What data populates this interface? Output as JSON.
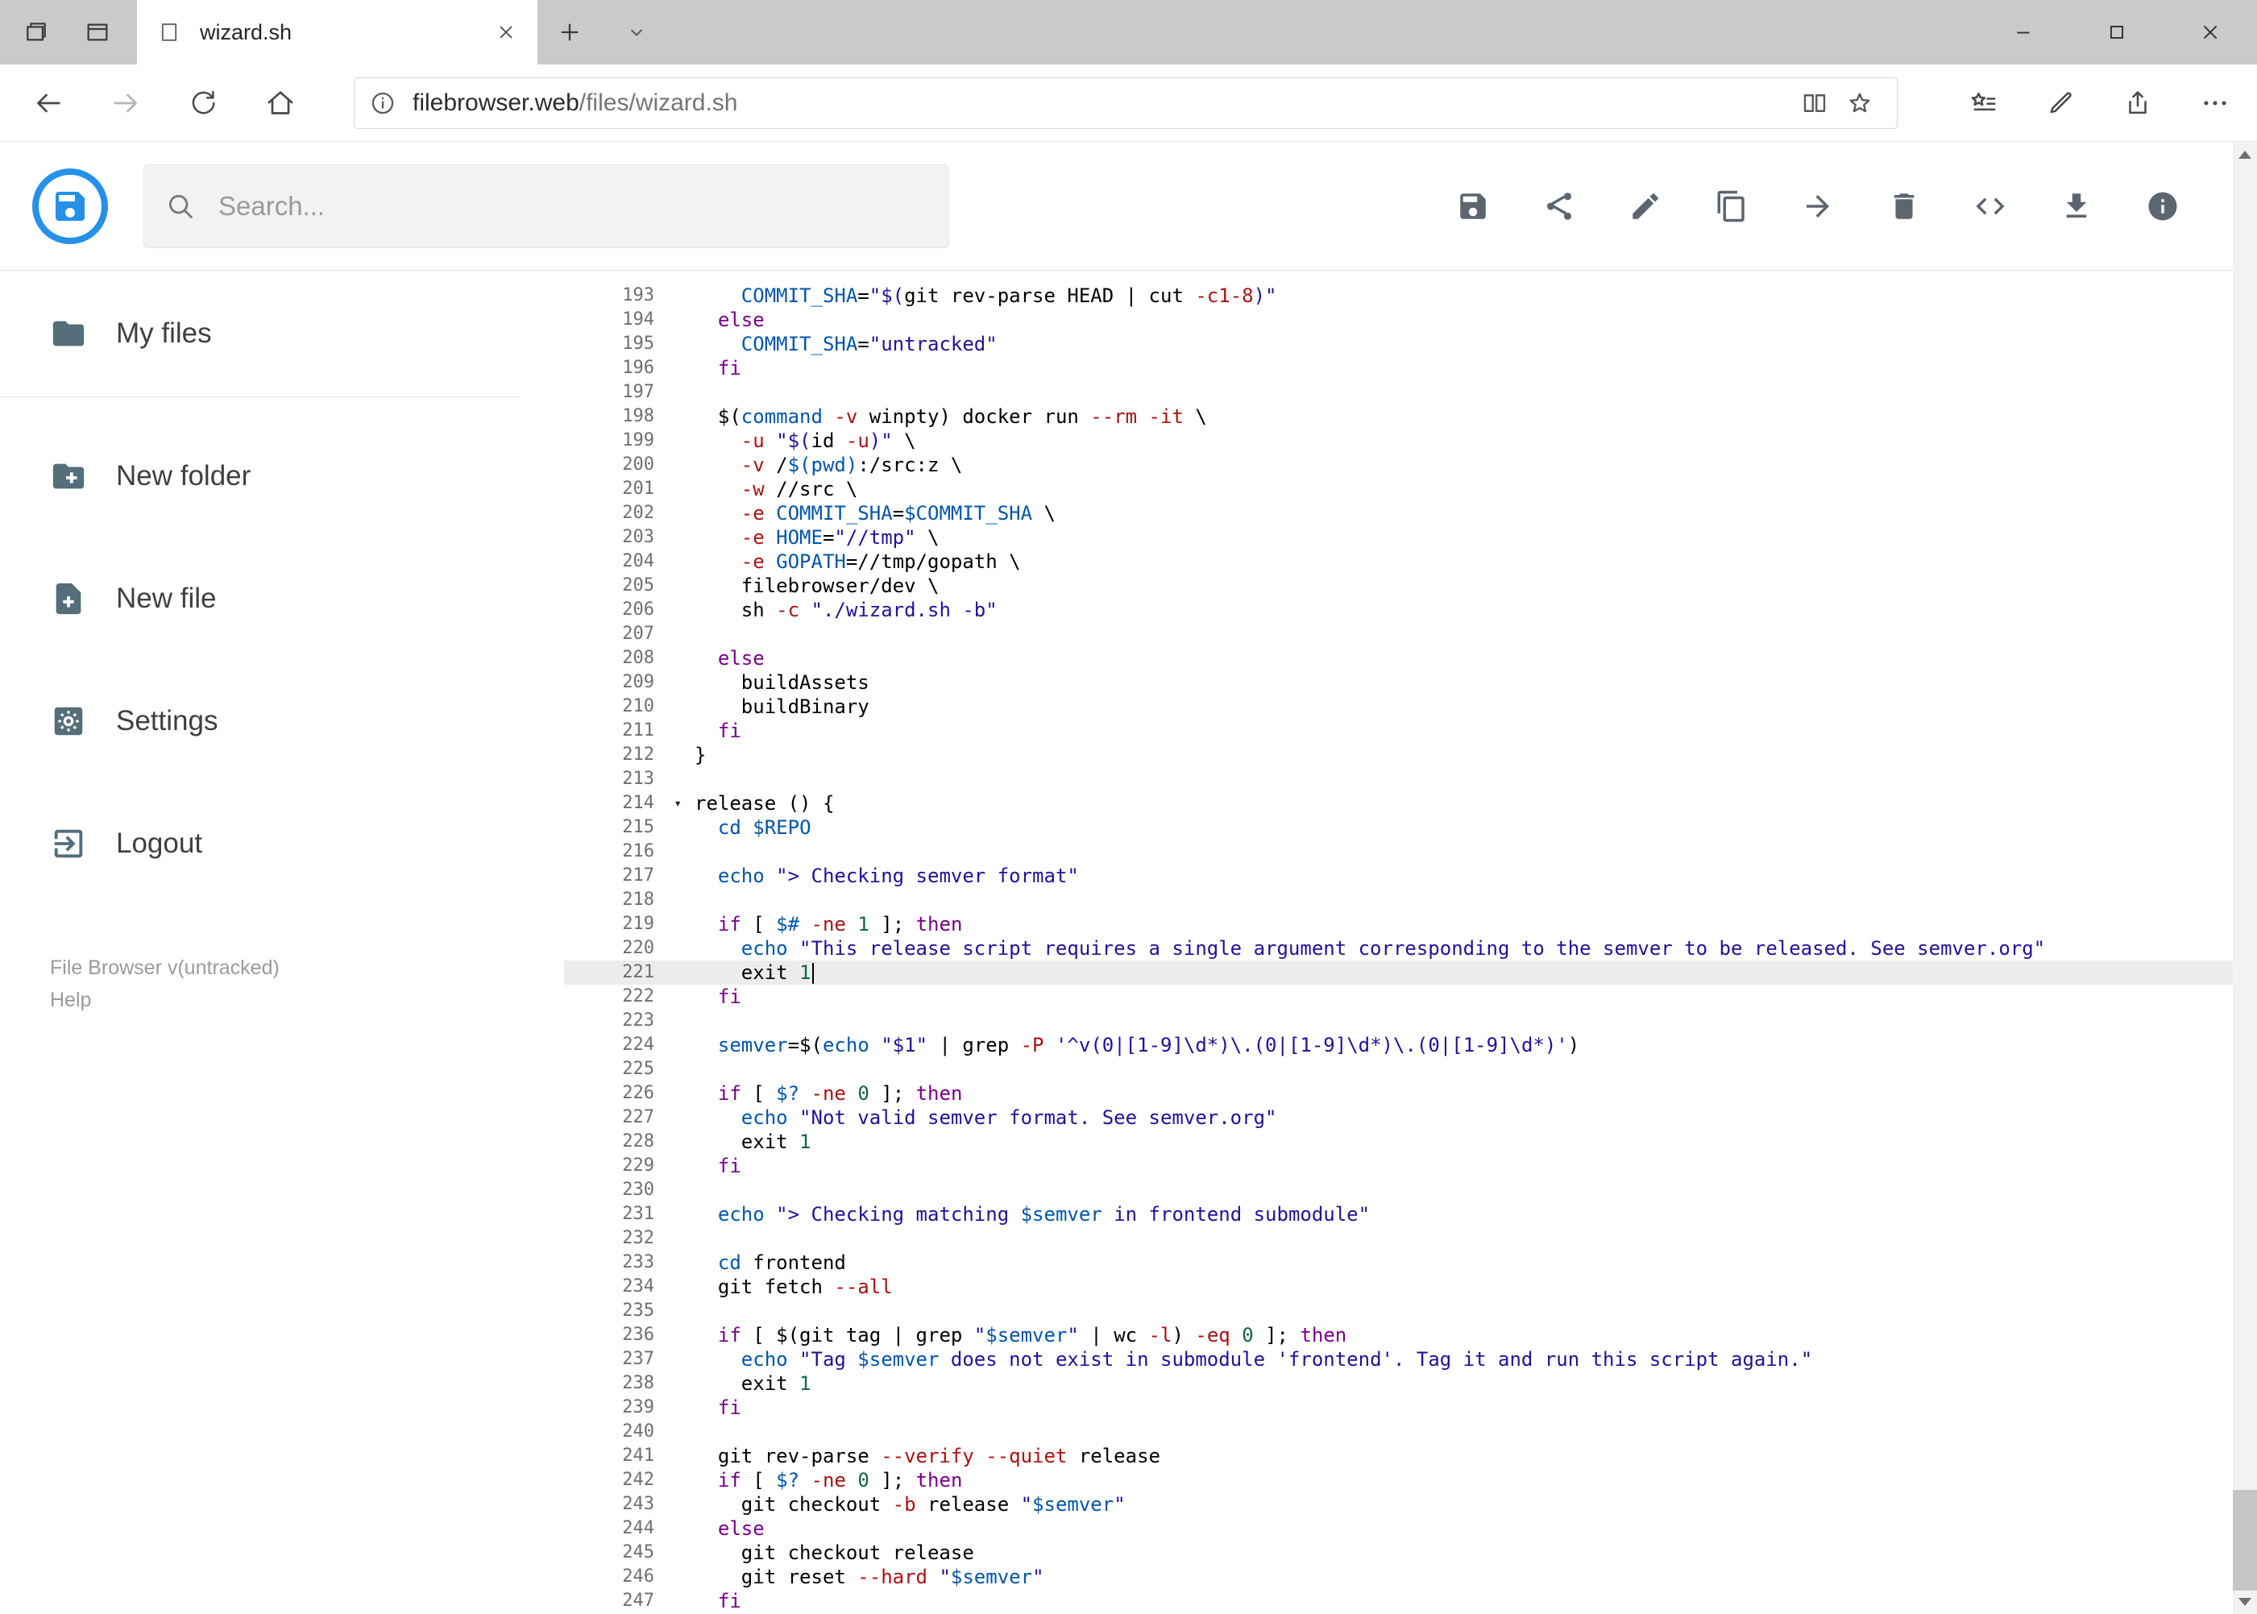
{
  "browser": {
    "tab_title": "wizard.sh",
    "url_domain": "filebrowser.web",
    "url_path": "/files/wizard.sh",
    "window_buttons": [
      "minimize",
      "maximize",
      "close"
    ]
  },
  "app": {
    "search_placeholder": "Search...",
    "toolbar_icons": [
      "save",
      "share",
      "edit",
      "copy",
      "move",
      "delete",
      "code",
      "download",
      "info"
    ],
    "accent_color": "#2591e9",
    "icon_color": "#5b6670"
  },
  "sidebar": {
    "items": [
      {
        "label": "My files",
        "icon": "folder-icon"
      },
      {
        "label": "New folder",
        "icon": "create-folder-icon"
      },
      {
        "label": "New file",
        "icon": "create-file-icon"
      },
      {
        "label": "Settings",
        "icon": "settings-icon"
      },
      {
        "label": "Logout",
        "icon": "logout-icon"
      }
    ],
    "version": "File Browser v(untracked)",
    "help": "Help"
  },
  "editor": {
    "language": "shell",
    "active_line": 221,
    "token_colors": {
      "p": "#000000",
      "k": "#770088",
      "v": "#0055aa",
      "s": "#221199",
      "f": "#aa1111",
      "n": "#116644"
    },
    "lines": [
      {
        "num": 193,
        "tokens": [
          [
            "p",
            "    "
          ],
          [
            "v",
            "COMMIT_SHA"
          ],
          [
            "p",
            "="
          ],
          [
            "s",
            "\"$("
          ],
          [
            "p",
            "git rev-parse HEAD | cut "
          ],
          [
            "f",
            "-c1-8"
          ],
          [
            "s",
            ")\""
          ]
        ]
      },
      {
        "num": 194,
        "tokens": [
          [
            "p",
            "  "
          ],
          [
            "k",
            "else"
          ]
        ]
      },
      {
        "num": 195,
        "tokens": [
          [
            "p",
            "    "
          ],
          [
            "v",
            "COMMIT_SHA"
          ],
          [
            "p",
            "="
          ],
          [
            "s",
            "\"untracked\""
          ]
        ]
      },
      {
        "num": 196,
        "tokens": [
          [
            "p",
            "  "
          ],
          [
            "k",
            "fi"
          ]
        ]
      },
      {
        "num": 197,
        "tokens": []
      },
      {
        "num": 198,
        "tokens": [
          [
            "p",
            "  $("
          ],
          [
            "v",
            "command"
          ],
          [
            "p",
            " "
          ],
          [
            "f",
            "-v"
          ],
          [
            "p",
            " winpty) docker run "
          ],
          [
            "f",
            "--rm -it"
          ],
          [
            "p",
            " \\"
          ]
        ]
      },
      {
        "num": 199,
        "tokens": [
          [
            "p",
            "    "
          ],
          [
            "f",
            "-u"
          ],
          [
            "p",
            " "
          ],
          [
            "s",
            "\"$("
          ],
          [
            "p",
            "id "
          ],
          [
            "f",
            "-u"
          ],
          [
            "s",
            ")\""
          ],
          [
            "p",
            " \\"
          ]
        ]
      },
      {
        "num": 200,
        "tokens": [
          [
            "p",
            "    "
          ],
          [
            "f",
            "-v"
          ],
          [
            "p",
            " /"
          ],
          [
            "v",
            "$(pwd)"
          ],
          [
            "p",
            ":/src:z \\"
          ]
        ]
      },
      {
        "num": 201,
        "tokens": [
          [
            "p",
            "    "
          ],
          [
            "f",
            "-w"
          ],
          [
            "p",
            " //src \\"
          ]
        ]
      },
      {
        "num": 202,
        "tokens": [
          [
            "p",
            "    "
          ],
          [
            "f",
            "-e"
          ],
          [
            "p",
            " "
          ],
          [
            "v",
            "COMMIT_SHA"
          ],
          [
            "p",
            "="
          ],
          [
            "v",
            "$COMMIT_SHA"
          ],
          [
            "p",
            " \\"
          ]
        ]
      },
      {
        "num": 203,
        "tokens": [
          [
            "p",
            "    "
          ],
          [
            "f",
            "-e"
          ],
          [
            "p",
            " "
          ],
          [
            "v",
            "HOME"
          ],
          [
            "p",
            "="
          ],
          [
            "s",
            "\"//tmp\""
          ],
          [
            "p",
            " \\"
          ]
        ]
      },
      {
        "num": 204,
        "tokens": [
          [
            "p",
            "    "
          ],
          [
            "f",
            "-e"
          ],
          [
            "p",
            " "
          ],
          [
            "v",
            "GOPATH"
          ],
          [
            "p",
            "=//tmp/gopath \\"
          ]
        ]
      },
      {
        "num": 205,
        "tokens": [
          [
            "p",
            "    filebrowser/dev \\"
          ]
        ]
      },
      {
        "num": 206,
        "tokens": [
          [
            "p",
            "    sh "
          ],
          [
            "f",
            "-c"
          ],
          [
            "p",
            " "
          ],
          [
            "s",
            "\"./wizard.sh -b\""
          ]
        ]
      },
      {
        "num": 207,
        "tokens": []
      },
      {
        "num": 208,
        "tokens": [
          [
            "p",
            "  "
          ],
          [
            "k",
            "else"
          ]
        ]
      },
      {
        "num": 209,
        "tokens": [
          [
            "p",
            "    buildAssets"
          ]
        ]
      },
      {
        "num": 210,
        "tokens": [
          [
            "p",
            "    buildBinary"
          ]
        ]
      },
      {
        "num": 211,
        "tokens": [
          [
            "p",
            "  "
          ],
          [
            "k",
            "fi"
          ]
        ]
      },
      {
        "num": 212,
        "tokens": [
          [
            "p",
            "}"
          ]
        ]
      },
      {
        "num": 213,
        "tokens": []
      },
      {
        "num": 214,
        "fold": true,
        "tokens": [
          [
            "p",
            "release () {"
          ]
        ]
      },
      {
        "num": 215,
        "tokens": [
          [
            "p",
            "  "
          ],
          [
            "v",
            "cd"
          ],
          [
            "p",
            " "
          ],
          [
            "v",
            "$REPO"
          ]
        ]
      },
      {
        "num": 216,
        "tokens": []
      },
      {
        "num": 217,
        "tokens": [
          [
            "p",
            "  "
          ],
          [
            "v",
            "echo"
          ],
          [
            "p",
            " "
          ],
          [
            "s",
            "\"> Checking semver format\""
          ]
        ]
      },
      {
        "num": 218,
        "tokens": []
      },
      {
        "num": 219,
        "tokens": [
          [
            "p",
            "  "
          ],
          [
            "k",
            "if"
          ],
          [
            "p",
            " [ "
          ],
          [
            "v",
            "$#"
          ],
          [
            "p",
            " "
          ],
          [
            "f",
            "-ne"
          ],
          [
            "p",
            " "
          ],
          [
            "n",
            "1"
          ],
          [
            "p",
            " ]; "
          ],
          [
            "k",
            "then"
          ]
        ]
      },
      {
        "num": 220,
        "tokens": [
          [
            "p",
            "    "
          ],
          [
            "v",
            "echo"
          ],
          [
            "p",
            " "
          ],
          [
            "s",
            "\"This release script requires a single argument corresponding to the semver to be released. See semver.org\""
          ]
        ]
      },
      {
        "num": 221,
        "tokens": [
          [
            "p",
            "    exit "
          ],
          [
            "n",
            "1"
          ]
        ]
      },
      {
        "num": 222,
        "tokens": [
          [
            "p",
            "  "
          ],
          [
            "k",
            "fi"
          ]
        ]
      },
      {
        "num": 223,
        "tokens": []
      },
      {
        "num": 224,
        "tokens": [
          [
            "p",
            "  "
          ],
          [
            "v",
            "semver"
          ],
          [
            "p",
            "=$("
          ],
          [
            "v",
            "echo"
          ],
          [
            "p",
            " "
          ],
          [
            "s",
            "\"$1\""
          ],
          [
            "p",
            " | grep "
          ],
          [
            "f",
            "-P"
          ],
          [
            "p",
            " "
          ],
          [
            "s",
            "'^v(0|[1-9]\\d*)\\.(0|[1-9]\\d*)\\.(0|[1-9]\\d*)'"
          ],
          [
            "p",
            ")"
          ]
        ]
      },
      {
        "num": 225,
        "tokens": []
      },
      {
        "num": 226,
        "tokens": [
          [
            "p",
            "  "
          ],
          [
            "k",
            "if"
          ],
          [
            "p",
            " [ "
          ],
          [
            "v",
            "$?"
          ],
          [
            "p",
            " "
          ],
          [
            "f",
            "-ne"
          ],
          [
            "p",
            " "
          ],
          [
            "n",
            "0"
          ],
          [
            "p",
            " ]; "
          ],
          [
            "k",
            "then"
          ]
        ]
      },
      {
        "num": 227,
        "tokens": [
          [
            "p",
            "    "
          ],
          [
            "v",
            "echo"
          ],
          [
            "p",
            " "
          ],
          [
            "s",
            "\"Not valid semver format. See semver.org\""
          ]
        ]
      },
      {
        "num": 228,
        "tokens": [
          [
            "p",
            "    exit "
          ],
          [
            "n",
            "1"
          ]
        ]
      },
      {
        "num": 229,
        "tokens": [
          [
            "p",
            "  "
          ],
          [
            "k",
            "fi"
          ]
        ]
      },
      {
        "num": 230,
        "tokens": []
      },
      {
        "num": 231,
        "tokens": [
          [
            "p",
            "  "
          ],
          [
            "v",
            "echo"
          ],
          [
            "p",
            " "
          ],
          [
            "s",
            "\"> Checking matching "
          ],
          [
            "v",
            "$semver"
          ],
          [
            "s",
            " in frontend submodule\""
          ]
        ]
      },
      {
        "num": 232,
        "tokens": []
      },
      {
        "num": 233,
        "tokens": [
          [
            "p",
            "  "
          ],
          [
            "v",
            "cd"
          ],
          [
            "p",
            " frontend"
          ]
        ]
      },
      {
        "num": 234,
        "tokens": [
          [
            "p",
            "  git fetch "
          ],
          [
            "f",
            "--all"
          ]
        ]
      },
      {
        "num": 235,
        "tokens": []
      },
      {
        "num": 236,
        "tokens": [
          [
            "p",
            "  "
          ],
          [
            "k",
            "if"
          ],
          [
            "p",
            " [ $(git tag | grep "
          ],
          [
            "s",
            "\""
          ],
          [
            "v",
            "$semver"
          ],
          [
            "s",
            "\""
          ],
          [
            "p",
            " | wc "
          ],
          [
            "f",
            "-l"
          ],
          [
            "p",
            ") "
          ],
          [
            "f",
            "-eq"
          ],
          [
            "p",
            " "
          ],
          [
            "n",
            "0"
          ],
          [
            "p",
            " ]; "
          ],
          [
            "k",
            "then"
          ]
        ]
      },
      {
        "num": 237,
        "tokens": [
          [
            "p",
            "    "
          ],
          [
            "v",
            "echo"
          ],
          [
            "p",
            " "
          ],
          [
            "s",
            "\"Tag "
          ],
          [
            "v",
            "$semver"
          ],
          [
            "s",
            " does not exist in submodule 'frontend'. Tag it and run this script again.\""
          ]
        ]
      },
      {
        "num": 238,
        "tokens": [
          [
            "p",
            "    exit "
          ],
          [
            "n",
            "1"
          ]
        ]
      },
      {
        "num": 239,
        "tokens": [
          [
            "p",
            "  "
          ],
          [
            "k",
            "fi"
          ]
        ]
      },
      {
        "num": 240,
        "tokens": []
      },
      {
        "num": 241,
        "tokens": [
          [
            "p",
            "  git rev-parse "
          ],
          [
            "f",
            "--verify --quiet"
          ],
          [
            "p",
            " release"
          ]
        ]
      },
      {
        "num": 242,
        "tokens": [
          [
            "p",
            "  "
          ],
          [
            "k",
            "if"
          ],
          [
            "p",
            " [ "
          ],
          [
            "v",
            "$?"
          ],
          [
            "p",
            " "
          ],
          [
            "f",
            "-ne"
          ],
          [
            "p",
            " "
          ],
          [
            "n",
            "0"
          ],
          [
            "p",
            " ]; "
          ],
          [
            "k",
            "then"
          ]
        ]
      },
      {
        "num": 243,
        "tokens": [
          [
            "p",
            "    git checkout "
          ],
          [
            "f",
            "-b"
          ],
          [
            "p",
            " release "
          ],
          [
            "s",
            "\""
          ],
          [
            "v",
            "$semver"
          ],
          [
            "s",
            "\""
          ]
        ]
      },
      {
        "num": 244,
        "tokens": [
          [
            "p",
            "  "
          ],
          [
            "k",
            "else"
          ]
        ]
      },
      {
        "num": 245,
        "tokens": [
          [
            "p",
            "    git checkout release"
          ]
        ]
      },
      {
        "num": 246,
        "tokens": [
          [
            "p",
            "    git reset "
          ],
          [
            "f",
            "--hard"
          ],
          [
            "p",
            " "
          ],
          [
            "s",
            "\""
          ],
          [
            "v",
            "$semver"
          ],
          [
            "s",
            "\""
          ]
        ]
      },
      {
        "num": 247,
        "tokens": [
          [
            "p",
            "  "
          ],
          [
            "k",
            "fi"
          ]
        ]
      }
    ]
  }
}
